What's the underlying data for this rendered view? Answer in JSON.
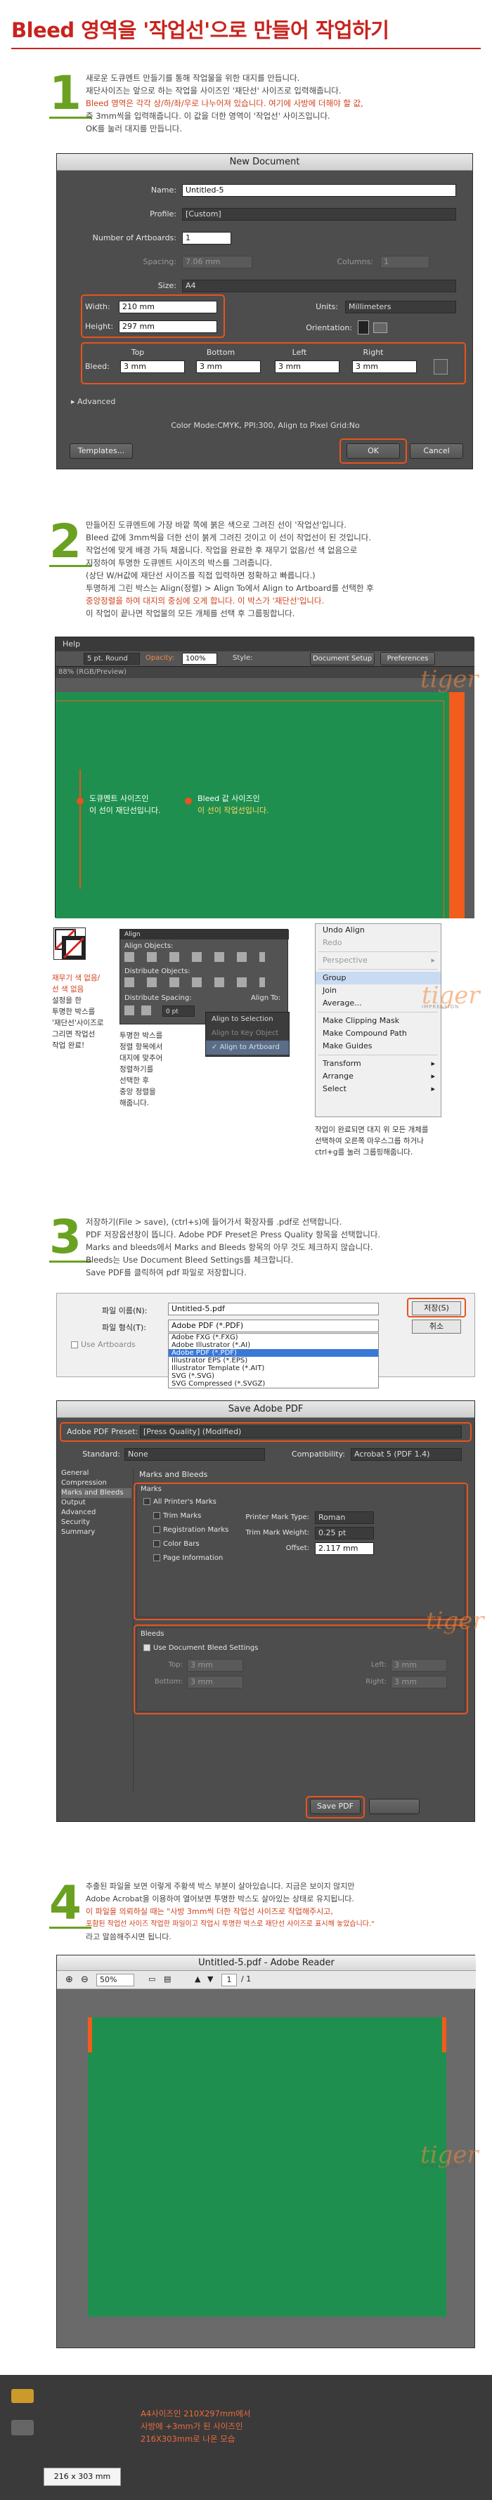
{
  "header": {
    "title": "Bleed 영역을 '작업선'으로 만들어 작업하기"
  },
  "steps": [
    {
      "num": "1"
    },
    {
      "num": "2"
    },
    {
      "num": "3"
    },
    {
      "num": "4"
    }
  ],
  "step1": {
    "lines": [
      {
        "t": "새로운 도큐멘트 만들기를 통해 작업물을 위한 대지를 만듭니다.",
        "r": false
      },
      {
        "t": "재단사이즈는 앞으로 하는 작업을 사이즈인 '재단선' 사이즈로 입력해줍니다.",
        "r": false
      },
      {
        "t": "Bleed 영역은 각각 상/하/좌/우로 나누어져 있습니다. 여기에 사방에 더해야 할 값,",
        "r": false
      },
      {
        "t": "즉 3mm씩을 입력해줍니다. 이 값을 더한 영역이 '작업선' 사이즈입니다.",
        "r": false
      },
      {
        "t": "OK를 눌러 대지를 만듭니다.",
        "r": false
      }
    ],
    "dialog": {
      "title": "New Document",
      "name_label": "Name:",
      "name_value": "Untitled-5",
      "profile_label": "Profile:",
      "profile_value": "[Custom]",
      "artboards_label": "Number of Artboards:",
      "artboards_value": "1",
      "spacing_label": "Spacing:",
      "spacing_value": "7.06 mm",
      "columns_label": "Columns:",
      "columns_value": "1",
      "size_label": "Size:",
      "size_value": "A4",
      "width_label": "Width:",
      "width_value": "210 mm",
      "units_label": "Units:",
      "units_value": "Millimeters",
      "height_label": "Height:",
      "height_value": "297 mm",
      "orientation_label": "Orientation:",
      "top_label": "Top",
      "bottom_label": "Bottom",
      "left_label": "Left",
      "right_label": "Right",
      "bleed_label": "Bleed:",
      "bleed_top": "3 mm",
      "bleed_bottom": "3 mm",
      "bleed_left": "3 mm",
      "bleed_right": "3 mm",
      "advanced_label": "Advanced",
      "color_mode": "Color Mode:CMYK, PPI:300, Align to Pixel Grid:No",
      "templates_btn": "Templates...",
      "ok_btn": "OK",
      "cancel_btn": "Cancel"
    }
  },
  "step2": {
    "lines": [
      "만들어진 도큐멘트에 가장 바깥 쪽에 붉은 색으로 그려진 선이 '작업선'입니다.",
      "Bleed 값에 3mm씩을 더한 선이 붉게 그려진 것이고 이 선이 작업선이 된 것입니다.",
      "작업선에 맞게 배경 가득 채웁니다.  작업을 완료한 후 재무기 없음/선 색 없음으로",
      "지정하여 투명한 도큐멘트 사이즈의 박스를 그려줍니다.",
      "(상단 W/H값에 재단선 사이즈를 직접 입력하면 정확하고 빠릅니다.)",
      "투명하게 그린 박스는 Align(정렬) > Align To에서 Align to Artboard를 선택한 후",
      "중앙정렬을 하여 대지의 중심에 오게 합니다. 이 박스가 '재단선'입니다.",
      "이 작업이 끝나면 작업물의 모든 개체를 선택 후 그룹핑합니다."
    ],
    "toolbar": {
      "menu_help": "Help",
      "stroke": "5 pt. Round",
      "opacity": "Opacity:",
      "opacity_val": "100%",
      "style": "Style:",
      "doc_setup": "Document Setup",
      "prefs": "Preferences",
      "doc_tab": "88% (RGB/Preview)"
    },
    "callout_left": {
      "line1": "도큐멘트 사이즈인",
      "line2": "이 선이 재단선입니다."
    },
    "callout_right": {
      "line1": "Bleed 값 사이즈인",
      "line2": "이 선이 작업선입니다."
    },
    "swatch_note": [
      "재무기 색 없음/",
      "선 색 없음",
      "설정을 한",
      "투명한 박스를",
      "'재단선'사이즈로",
      "그리면 작업선",
      "작업 완료!"
    ],
    "align_panel": {
      "title": "Align",
      "align_objects": "Align Objects:",
      "distribute_objects": "Distribute Objects:",
      "distribute_spacing": "Distribute Spacing:",
      "align_to": "Align To:",
      "spacing_value": "0 pt"
    },
    "align_to_menu": {
      "item1": "Align to Selection",
      "item2": "Align to Key Object",
      "item3": "Align to Artboard"
    },
    "align_note": [
      "투명한 박스를",
      "정렬 항목에서",
      "대지에 맞추어",
      "정렬하기를",
      "선택한 후",
      "중앙 정렬을",
      "해줍니다."
    ],
    "context_menu": {
      "items": [
        "Undo Align",
        "Redo",
        "Perspective",
        "Group",
        "Join",
        "Average...",
        "Make Clipping Mask",
        "Make Compound Path",
        "Make Guides",
        "Transform",
        "Arrange",
        "Select"
      ]
    },
    "group_note": [
      "작업이 완료되면 대지 위 모든 개체를",
      "선택하여 오른쪽 마우스그룹 하거나",
      "ctrl+g를 눌러 그룹핑해줍니다."
    ]
  },
  "step3": {
    "lines": [
      "저장하기(File > save), (ctrl+s)에 들어가서 확장자를 .pdf로 선택합니다.",
      "PDF 저장옵션창이 뜹니다.  Adobe PDF Preset은 Press Quality 항목을 선택합니다.",
      "Marks and bleeds에서 Marks and Bleeds 항목의 아무 것도 체크하지 않습니다.",
      "Bleeds는 Use Document Bleed Settings를 체크합니다.",
      "Save PDF를 클릭하여 pdf 파일로 저장합니다."
    ],
    "save_dialog": {
      "filename_label": "파일 이름(N):",
      "filename_value": "Untitled-5.pdf",
      "filetype_label": "파일 형식(T):",
      "filetype_value": "Adobe PDF (*.PDF)",
      "save_btn": "저장(S)",
      "cancel_btn": "취소",
      "use_artboards": "Use Artboards",
      "options": [
        "Adobe FXG (*.FXG)",
        "Adobe Illustrator (*.AI)",
        "Adobe PDF (*.PDF)",
        "Illustrator EPS (*.EPS)",
        "Illustrator Template (*.AIT)",
        "SVG (*.SVG)",
        "SVG Compressed (*.SVGZ)"
      ]
    },
    "pdf_dialog": {
      "title": "Save Adobe PDF",
      "preset_label": "Adobe PDF Preset:",
      "preset_value": "[Press Quality] (Modified)",
      "standard_label": "Standard:",
      "standard_value": "None",
      "compat_label": "Compatibility:",
      "compat_value": "Acrobat 5 (PDF 1.4)",
      "nav": [
        "General",
        "Compression",
        "Marks and Bleeds",
        "Output",
        "Advanced",
        "Security",
        "Summary"
      ],
      "section_title": "Marks and Bleeds",
      "marks_title": "Marks",
      "all_printers": "All Printer's Marks",
      "trim_marks": "Trim Marks",
      "reg_marks": "Registration Marks",
      "color_bars": "Color Bars",
      "page_info": "Page Information",
      "mark_type_label": "Printer Mark Type:",
      "mark_type_value": "Roman",
      "weight_label": "Trim Mark Weight:",
      "weight_value": "0.25 pt",
      "offset_label": "Offset:",
      "offset_value": "2.117 mm",
      "bleeds_title": "Bleeds",
      "use_doc_bleed": "Use Document Bleed Settings",
      "top_label": "Top:",
      "top_value": "3 mm",
      "bottom_label": "Bottom:",
      "bottom_value": "3 mm",
      "left_label": "Left:",
      "left_value": "3 mm",
      "right_label": "Right:",
      "right_value": "3 mm",
      "save_btn": "Save PDF"
    }
  },
  "step4": {
    "lines": [
      "추출된 파일을 보면 이렇게 주황색 박스 부분이 살아있습니다. 지금은 보이지 않지만",
      "Adobe Acrobat을 이용하여 열어보면 투명한 박스도 살아있는 상태로 유지됩니다.",
      "이 파일을 의뢰하실 때는 \"사방 3mm씩 더한 작업선 사이즈로 작업해주시고,",
      "포함된 작업선 사이즈 작업한 파일이고 작업시 투명한 박스로 재단선 사이즈로 표시해 놓았습니다.\"",
      "라고 말씀해주시면 됩니다."
    ],
    "reader": {
      "title": "Untitled-5.pdf - Adobe Reader",
      "page": "1",
      "total": "/ 1",
      "zoom": "50%"
    },
    "note": {
      "line1": "A4사이즈인 210X297mm에서",
      "line2": "사방에 +3mm가 된 사이즈인",
      "line3": "216X303mm로 나온 모습"
    },
    "size_readout": "216 x 303 mm"
  },
  "watermark": {
    "text": "tiger",
    "sub": "IMPRESSION"
  },
  "colors": {
    "accent_red": "#c8231d",
    "step_green": "#6aa121",
    "artboard_green": "#1e8f4e",
    "bleed_orange": "#f25c1c"
  }
}
